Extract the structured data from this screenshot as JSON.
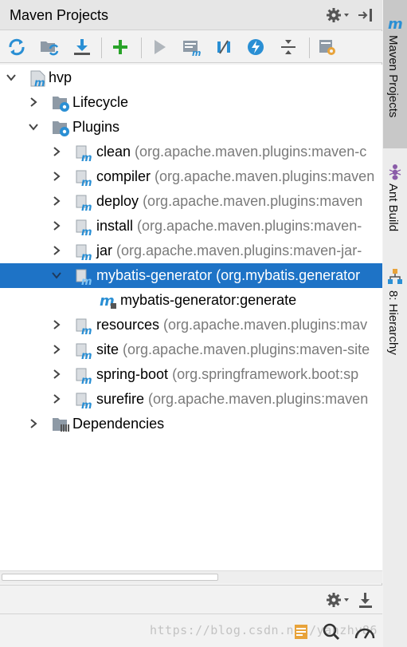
{
  "header": {
    "title": "Maven Projects"
  },
  "tree": {
    "root": {
      "label": "hvp"
    },
    "lifecycle": {
      "label": "Lifecycle"
    },
    "plugins": {
      "label": "Plugins",
      "items": [
        {
          "name": "clean",
          "hint": "(org.apache.maven.plugins:maven-c"
        },
        {
          "name": "compiler",
          "hint": "(org.apache.maven.plugins:maven"
        },
        {
          "name": "deploy",
          "hint": "(org.apache.maven.plugins:maven"
        },
        {
          "name": "install",
          "hint": "(org.apache.maven.plugins:maven-"
        },
        {
          "name": "jar",
          "hint": "(org.apache.maven.plugins:maven-jar-"
        },
        {
          "name": "mybatis-generator",
          "hint": "(org.mybatis.generator"
        },
        {
          "name": "resources",
          "hint": "(org.apache.maven.plugins:mav"
        },
        {
          "name": "site",
          "hint": "(org.apache.maven.plugins:maven-site"
        },
        {
          "name": "spring-boot",
          "hint": "(org.springframework.boot:sp"
        },
        {
          "name": "surefire",
          "hint": "(org.apache.maven.plugins:maven"
        }
      ],
      "goal": {
        "label": "mybatis-generator:generate"
      }
    },
    "dependencies": {
      "label": "Dependencies"
    }
  },
  "footer": {
    "watermark": "https://blog.csdn.net/yanzhy86"
  },
  "right_tabs": [
    {
      "label": "Maven Projects"
    },
    {
      "label": "Ant Build"
    },
    {
      "label": "8: Hierarchy"
    }
  ],
  "colors": {
    "selection": "#1e73c6",
    "accent_blue": "#2a8fd4",
    "green": "#29a329"
  }
}
